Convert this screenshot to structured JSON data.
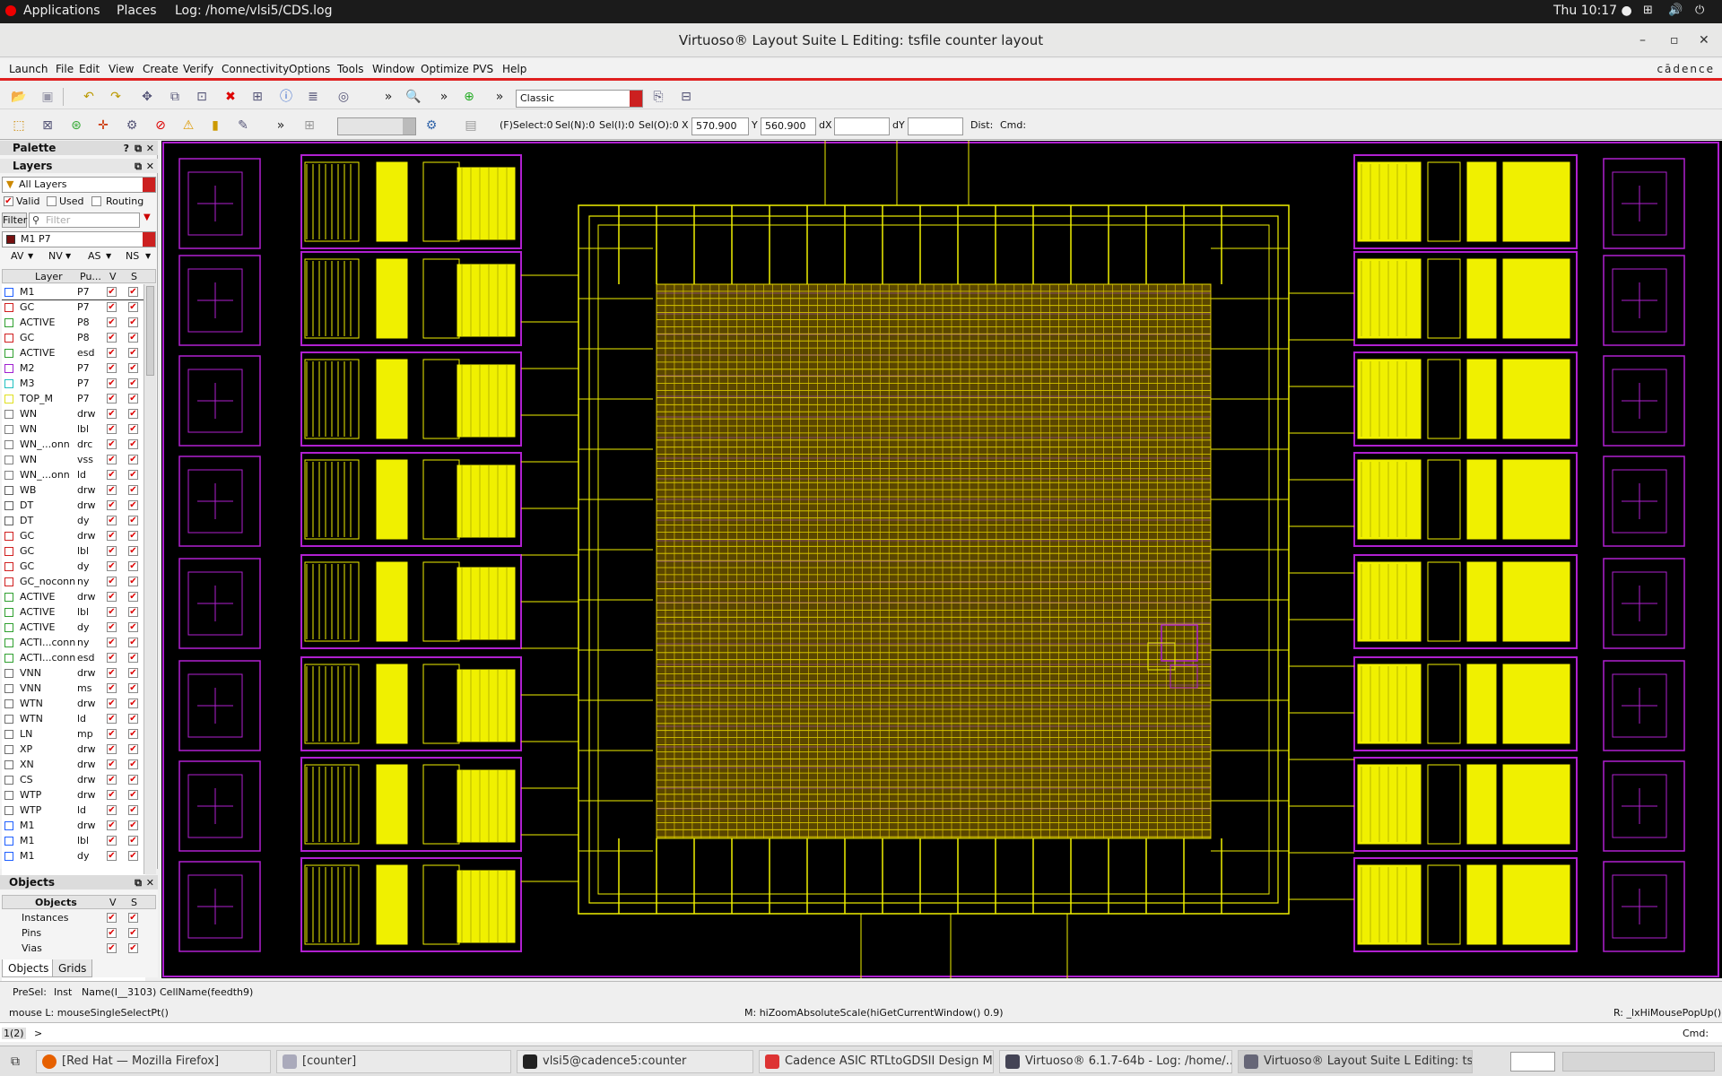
{
  "topbar": {
    "applications": "Applications",
    "places": "Places",
    "log": "Log: /home/vlsi5/CDS.log",
    "clock": "Thu 10:17 ●"
  },
  "window": {
    "title": "Virtuoso® Layout Suite L Editing: tsfile counter layout"
  },
  "menu": {
    "items": [
      "Launch",
      "File",
      "Edit",
      "View",
      "Create",
      "Verify",
      "Connectivity",
      "Options",
      "Tools",
      "Window",
      "Optimize",
      "PVS",
      "Help"
    ],
    "brand": "cādence"
  },
  "toolbar": {
    "workspace": "Classic"
  },
  "toolbar2": {
    "fselect": "(F)Select:0",
    "seln": "Sel(N):0",
    "seli": "Sel(I):0",
    "selo": "Sel(O):0",
    "x_label": "X",
    "x_value": "570.900",
    "y_label": "Y",
    "y_value": "560.900",
    "dx_label": "dX",
    "dy_label": "dY",
    "dist_label": "Dist:",
    "cmd_label": "Cmd:"
  },
  "palette": {
    "title": "Palette",
    "layers_title": "Layers",
    "filter_set": "All Layers",
    "valid": "Valid",
    "used": "Used",
    "routing": "Routing",
    "filter_button": "Filter",
    "filter_placeholder": "Filter",
    "current_layer": "M1 P7",
    "view_av": "AV",
    "view_nv": "NV",
    "view_as": "AS",
    "view_ns": "NS",
    "col_layer": "Layer",
    "col_purpose": "Pu...",
    "col_v": "V",
    "col_s": "S",
    "layers": [
      {
        "name": "M1",
        "purpose": "P7",
        "color": "#2060ff"
      },
      {
        "name": "GC",
        "purpose": "P7",
        "color": "#d02020"
      },
      {
        "name": "ACTIVE",
        "purpose": "P8",
        "color": "#30a030"
      },
      {
        "name": "GC",
        "purpose": "P8",
        "color": "#d02020"
      },
      {
        "name": "ACTIVE",
        "purpose": "esd",
        "color": "#30a030"
      },
      {
        "name": "M2",
        "purpose": "P7",
        "color": "#a020d0"
      },
      {
        "name": "M3",
        "purpose": "P7",
        "color": "#20c0c0"
      },
      {
        "name": "TOP_M",
        "purpose": "P7",
        "color": "#e0e020"
      },
      {
        "name": "WN",
        "purpose": "drw",
        "color": "#808080"
      },
      {
        "name": "WN",
        "purpose": "lbl",
        "color": "#808080"
      },
      {
        "name": "WN_...onn",
        "purpose": "drc",
        "color": "#808080"
      },
      {
        "name": "WN",
        "purpose": "vss",
        "color": "#808080"
      },
      {
        "name": "WN_...onn",
        "purpose": "ld",
        "color": "#808080"
      },
      {
        "name": "WB",
        "purpose": "drw",
        "color": "#606060"
      },
      {
        "name": "DT",
        "purpose": "drw",
        "color": "#606060"
      },
      {
        "name": "DT",
        "purpose": "dy",
        "color": "#606060"
      },
      {
        "name": "GC",
        "purpose": "drw",
        "color": "#d02020"
      },
      {
        "name": "GC",
        "purpose": "lbl",
        "color": "#d02020"
      },
      {
        "name": "GC",
        "purpose": "dy",
        "color": "#d02020"
      },
      {
        "name": "GC_noconn",
        "purpose": "ny",
        "color": "#d02020"
      },
      {
        "name": "ACTIVE",
        "purpose": "drw",
        "color": "#30a030"
      },
      {
        "name": "ACTIVE",
        "purpose": "lbl",
        "color": "#30a030"
      },
      {
        "name": "ACTIVE",
        "purpose": "dy",
        "color": "#30a030"
      },
      {
        "name": "ACTI...conn",
        "purpose": "ny",
        "color": "#30a030"
      },
      {
        "name": "ACTI...conn",
        "purpose": "esd",
        "color": "#30a030"
      },
      {
        "name": "VNN",
        "purpose": "drw",
        "color": "#707070"
      },
      {
        "name": "VNN",
        "purpose": "ms",
        "color": "#707070"
      },
      {
        "name": "WTN",
        "purpose": "drw",
        "color": "#707070"
      },
      {
        "name": "WTN",
        "purpose": "ld",
        "color": "#707070"
      },
      {
        "name": "LN",
        "purpose": "mp",
        "color": "#707070"
      },
      {
        "name": "XP",
        "purpose": "drw",
        "color": "#707070"
      },
      {
        "name": "XN",
        "purpose": "drw",
        "color": "#707070"
      },
      {
        "name": "CS",
        "purpose": "drw",
        "color": "#707070"
      },
      {
        "name": "WTP",
        "purpose": "drw",
        "color": "#707070"
      },
      {
        "name": "WTP",
        "purpose": "ld",
        "color": "#707070"
      },
      {
        "name": "M1",
        "purpose": "drw",
        "color": "#2060ff"
      },
      {
        "name": "M1",
        "purpose": "lbl",
        "color": "#2060ff"
      },
      {
        "name": "M1",
        "purpose": "dy",
        "color": "#2060ff"
      }
    ]
  },
  "objects": {
    "title": "Objects",
    "col_objects": "Objects",
    "col_v": "V",
    "col_s": "S",
    "items": [
      "Instances",
      "Pins",
      "Vias"
    ],
    "tabs": [
      "Objects",
      "Grids"
    ]
  },
  "status": {
    "presel": "PreSel:",
    "inst": "Inst",
    "name": "Name(I__3103)",
    "cellname": "CellName(feedth9)",
    "mouse_l": "mouse L: mouseSingleSelectPt()",
    "mouse_m": "M: hiZoomAbsoluteScale(hiGetCurrentWindow() 0.9)",
    "mouse_r": "R: _lxHiMousePopUp()",
    "prompt_num": "1(2)",
    "prompt": ">",
    "cmd": "Cmd:"
  },
  "taskbar": {
    "items": [
      "[Red Hat — Mozilla Firefox]",
      "[counter]",
      "vlsi5@cadence5:counter",
      "Cadence ASIC RTLtoGDSII Design M...",
      "Virtuoso® 6.1.7-64b - Log: /home/...",
      "Virtuoso® Layout Suite L Editing: ts..."
    ]
  }
}
